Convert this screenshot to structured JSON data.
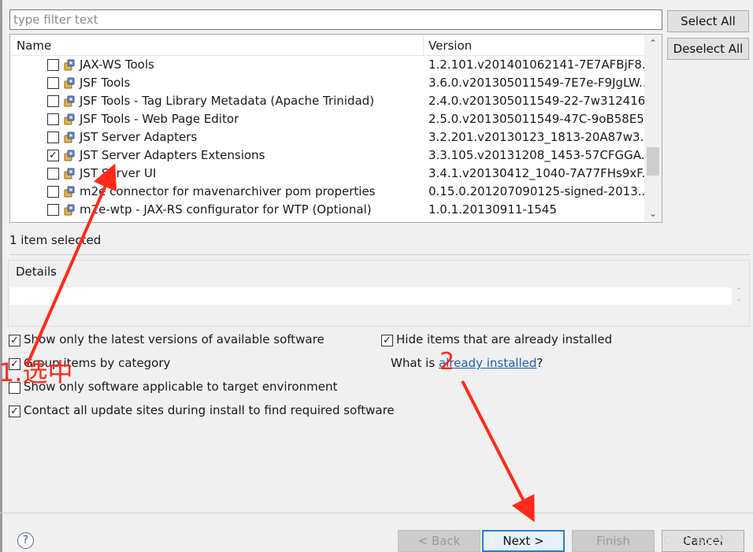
{
  "filter": {
    "placeholder": "type filter text",
    "value": ""
  },
  "side_buttons": {
    "select_all": "Select All",
    "deselect_all": "Deselect All"
  },
  "tree": {
    "headers": {
      "name": "Name",
      "version": "Version"
    },
    "items": [
      {
        "name": "JAX-WS Tools",
        "version": "1.2.101.v201401062141-7E7AFBjF8...",
        "checked": false
      },
      {
        "name": "JSF Tools",
        "version": "3.6.0.v201305011549-7E7e-F9JgLW...",
        "checked": false
      },
      {
        "name": "JSF Tools - Tag Library Metadata (Apache Trinidad)",
        "version": "2.4.0.v201305011549-22-7w312416...",
        "checked": false
      },
      {
        "name": "JSF Tools - Web Page Editor",
        "version": "2.5.0.v201305011549-47C-9oB58E5...",
        "checked": false
      },
      {
        "name": "JST Server Adapters",
        "version": "3.2.201.v20130123_1813-20A87w3...",
        "checked": false
      },
      {
        "name": "JST Server Adapters Extensions",
        "version": "3.3.105.v20131208_1453-57CFGGA...",
        "checked": true
      },
      {
        "name": "JST Server UI",
        "version": "3.4.1.v20130412_1040-7A77FHs9xF...",
        "checked": false
      },
      {
        "name": "m2e connector for mavenarchiver pom properties",
        "version": "0.15.0.201207090125-signed-2013...",
        "checked": false
      },
      {
        "name": "m2e-wtp - JAX-RS configurator for WTP (Optional)",
        "version": "1.0.1.20130911-1545",
        "checked": false
      }
    ]
  },
  "status": "1 item selected",
  "details": {
    "label": "Details",
    "text": ""
  },
  "options": {
    "latest_versions": {
      "label": "Show only the latest versions of available software",
      "checked": true
    },
    "group_by_category": {
      "label": "Group items by category",
      "checked": true
    },
    "target_env": {
      "label": "Show only software applicable to target environment",
      "checked": false
    },
    "contact_sites": {
      "label": "Contact all update sites during install to find required software",
      "checked": true
    },
    "hide_installed": {
      "label": "Hide items that are already installed",
      "checked": true
    },
    "what_is": {
      "prefix": "What is ",
      "link": "already installed",
      "suffix": "?"
    }
  },
  "footer": {
    "help": "?",
    "back": "< Back",
    "next": "Next >",
    "finish": "Finish",
    "cancel": "Cancel"
  },
  "annotations": {
    "label1": "1.选中",
    "label2": "2",
    "color": "#ff2a1a"
  },
  "watermark": "CSDN @云天帝"
}
